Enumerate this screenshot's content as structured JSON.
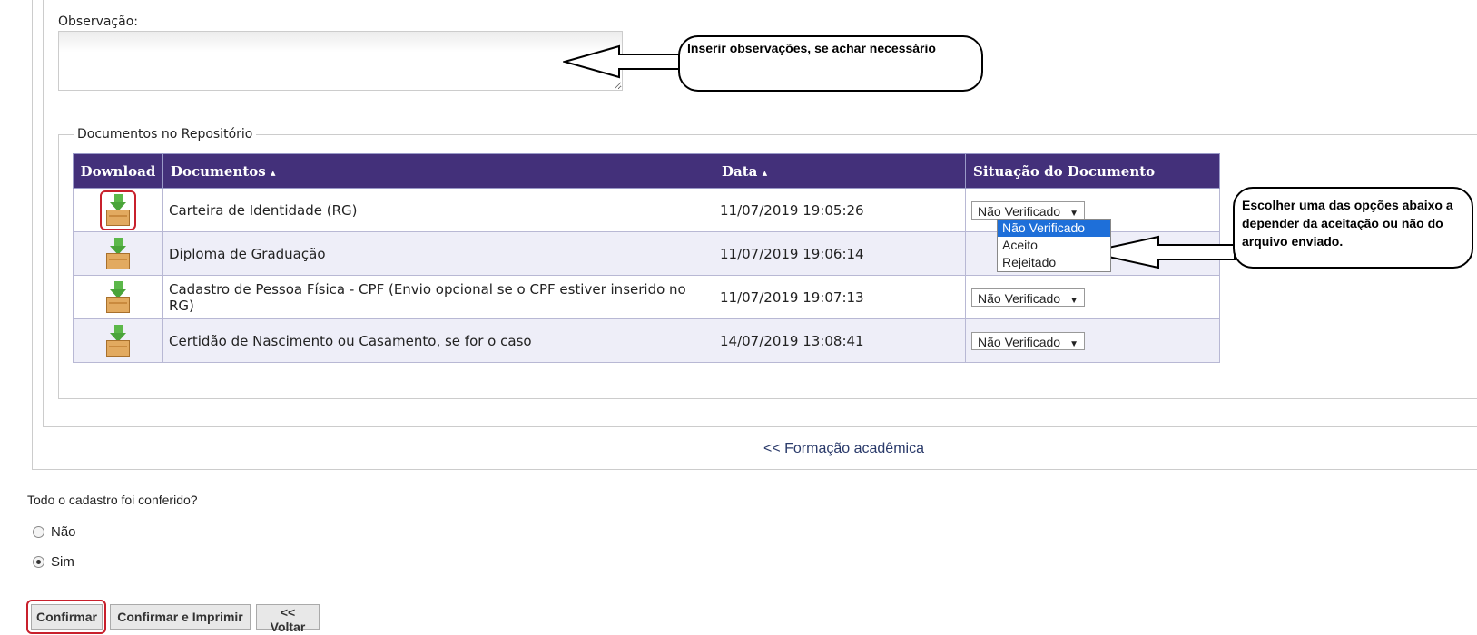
{
  "observation": {
    "label": "Observação:",
    "value": "",
    "callout": "Inserir observações, se achar necessário"
  },
  "repository": {
    "legend": "Documentos no Repositório",
    "columns": {
      "download": "Download",
      "documents": "Documentos",
      "date": "Data",
      "status": "Situação do Documento",
      "sort_icon": "sort-icon"
    },
    "rows": [
      {
        "document": "Carteira de Identidade (RG)",
        "date": "11/07/2019 19:05:26",
        "status": "Não Verificado"
      },
      {
        "document": "Diploma de Graduação",
        "date": "11/07/2019 19:06:14",
        "status": "Não Verificado"
      },
      {
        "document": "Cadastro de Pessoa Física - CPF (Envio opcional se o CPF estiver inserido no RG)",
        "date": "11/07/2019 19:07:13",
        "status": "Não Verificado"
      },
      {
        "document": "Certidão de Nascimento ou Casamento, se for o caso",
        "date": "14/07/2019 13:08:41",
        "status": "Não Verificado"
      }
    ],
    "status_options": [
      "Não Verificado",
      "Aceito",
      "Rejeitado"
    ],
    "callout": "Escolher uma das opções abaixo a depender da aceitação ou não do arquivo enviado."
  },
  "nav": {
    "academic_link": "<< Formação acadêmica"
  },
  "confirmation": {
    "question": "Todo o cadastro foi conferido?",
    "options": [
      {
        "label": "Não",
        "checked": false
      },
      {
        "label": "Sim",
        "checked": true
      }
    ]
  },
  "buttons": {
    "confirm": "Confirmar",
    "confirm_print": "Confirmar e Imprimir",
    "back": "<< Voltar"
  },
  "colors": {
    "header_bg": "#43307a",
    "highlight": "#c8202c",
    "dropdown_selected": "#1e6fd9"
  }
}
